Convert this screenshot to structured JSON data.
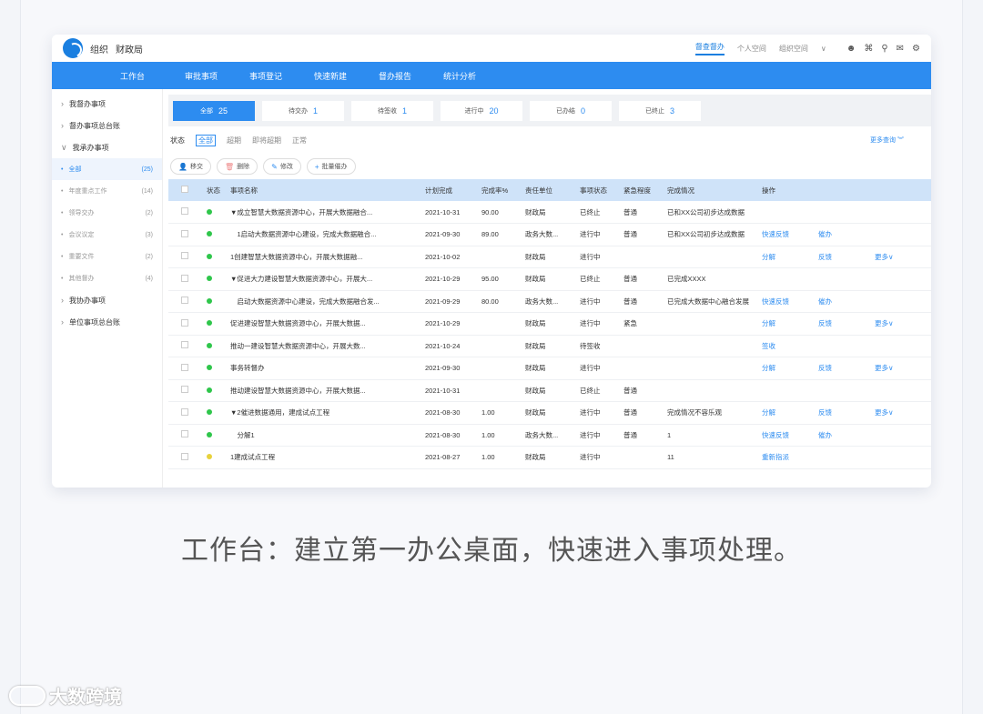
{
  "app": {
    "org_label": "组织",
    "org_name": "财政局",
    "top_links": [
      "督查督办",
      "个人空间",
      "组织空间"
    ],
    "top_dropdown": "∨"
  },
  "nav": [
    "工作台",
    "审批事项",
    "事项登记",
    "快速新建",
    "督办报告",
    "统计分析"
  ],
  "sidebar": {
    "groups_top": [
      {
        "label": "我督办事项",
        "chev": "›"
      },
      {
        "label": "督办事项总台账",
        "chev": "›"
      },
      {
        "label": "我承办事项",
        "chev": "∨"
      }
    ],
    "subs": [
      {
        "label": "全部",
        "count": "(25)"
      },
      {
        "label": "年度重点工作",
        "count": "(14)"
      },
      {
        "label": "领导交办",
        "count": "(2)"
      },
      {
        "label": "会议议定",
        "count": "(3)"
      },
      {
        "label": "重要文件",
        "count": "(2)"
      },
      {
        "label": "其他督办",
        "count": "(4)"
      }
    ],
    "groups_bottom": [
      {
        "label": "我协办事项",
        "chev": "›"
      },
      {
        "label": "单位事项总台账",
        "chev": "›"
      }
    ]
  },
  "status_tabs": [
    {
      "label": "全部",
      "num": "25"
    },
    {
      "label": "待交办",
      "num": "1"
    },
    {
      "label": "待签收",
      "num": "1"
    },
    {
      "label": "进行中",
      "num": "20"
    },
    {
      "label": "已办结",
      "num": "0"
    },
    {
      "label": "已终止",
      "num": "3"
    }
  ],
  "filter": {
    "label": "状态",
    "options": [
      "全部",
      "超期",
      "即将超期",
      "正常"
    ],
    "more": "更多查询"
  },
  "actions": [
    {
      "icon": "👤",
      "label": "移交"
    },
    {
      "icon": "🗑",
      "label": "删除"
    },
    {
      "icon": "✎",
      "label": "修改"
    },
    {
      "icon": "+",
      "label": "批量催办"
    }
  ],
  "table": {
    "headers": [
      "状态",
      "事项名称",
      "计划完成",
      "完成率%",
      "责任单位",
      "事项状态",
      "紧急程度",
      "完成情况",
      "操作"
    ],
    "rows": [
      {
        "dot": "green",
        "name": "▼成立智慧大数据资源中心，开展大数据融合...",
        "date": "2021-10-31",
        "rate": "90.00",
        "unit": "财政局",
        "state": "已终止",
        "urgency": "普通",
        "progress": "已和XX公司初步达成数据",
        "ops": [
          "",
          "",
          ""
        ]
      },
      {
        "dot": "green",
        "name": "　1启动大数据资源中心建设，完成大数据融合...",
        "date": "2021-09-30",
        "rate": "89.00",
        "unit": "政务大数...",
        "state": "进行中",
        "urgency": "普通",
        "progress": "已和XX公司初步达成数据",
        "ops": [
          "快速反馈",
          "催办",
          ""
        ]
      },
      {
        "dot": "green",
        "name": "1创建智慧大数据资源中心，开展大数据融...",
        "date": "2021-10-02",
        "rate": "",
        "unit": "财政局",
        "state": "进行中",
        "urgency": "",
        "progress": "",
        "ops": [
          "分解",
          "反馈",
          "更多∨"
        ]
      },
      {
        "dot": "green",
        "name": "▼促进大力建设智慧大数据资源中心，开展大...",
        "date": "2021-10-29",
        "rate": "95.00",
        "unit": "财政局",
        "state": "已终止",
        "urgency": "普通",
        "progress": "已完成XXXX",
        "ops": [
          "",
          "",
          ""
        ]
      },
      {
        "dot": "green",
        "name": "　启动大数据资源中心建设，完成大数据融合发...",
        "date": "2021-09-29",
        "rate": "80.00",
        "unit": "政务大数...",
        "state": "进行中",
        "urgency": "普通",
        "progress": "已完成大数据中心融合发展",
        "ops": [
          "快速反馈",
          "催办",
          ""
        ]
      },
      {
        "dot": "green",
        "name": "促进建设智慧大数据资源中心，开展大数据...",
        "date": "2021-10-29",
        "rate": "",
        "unit": "财政局",
        "state": "进行中",
        "urgency": "紧急",
        "progress": "",
        "ops": [
          "分解",
          "反馈",
          "更多∨"
        ]
      },
      {
        "dot": "green",
        "name": "推动一建设智慧大数据资源中心，开展大数...",
        "date": "2021-10-24",
        "rate": "",
        "unit": "财政局",
        "state": "待签收",
        "urgency": "",
        "progress": "",
        "ops": [
          "签收",
          "",
          ""
        ]
      },
      {
        "dot": "green",
        "name": "事务转督办",
        "date": "2021-09-30",
        "rate": "",
        "unit": "财政局",
        "state": "进行中",
        "urgency": "",
        "progress": "",
        "ops": [
          "分解",
          "反馈",
          "更多∨"
        ]
      },
      {
        "dot": "green",
        "name": "推动建设智慧大数据资源中心，开展大数据...",
        "date": "2021-10-31",
        "rate": "",
        "unit": "财政局",
        "state": "已终止",
        "urgency": "普通",
        "progress": "",
        "ops": [
          "",
          "",
          ""
        ]
      },
      {
        "dot": "green",
        "name": "▼2催进数据通用，建成试点工程",
        "date": "2021-08-30",
        "rate": "1.00",
        "unit": "财政局",
        "state": "进行中",
        "urgency": "普通",
        "progress": "完成情况不容乐观",
        "ops": [
          "分解",
          "反馈",
          "更多∨"
        ]
      },
      {
        "dot": "green",
        "name": "　分解1",
        "date": "2021-08-30",
        "rate": "1.00",
        "unit": "政务大数...",
        "state": "进行中",
        "urgency": "普通",
        "progress": "1",
        "ops": [
          "快速反馈",
          "催办",
          ""
        ]
      },
      {
        "dot": "yellow",
        "name": "1建成试点工程",
        "date": "2021-08-27",
        "rate": "1.00",
        "unit": "财政局",
        "state": "进行中",
        "urgency": "",
        "progress": "11",
        "ops": [
          "重新指派",
          "",
          ""
        ]
      }
    ]
  },
  "caption": "工作台：建立第一办公桌面，快速进入事项处理。",
  "watermark": "大数跨境"
}
